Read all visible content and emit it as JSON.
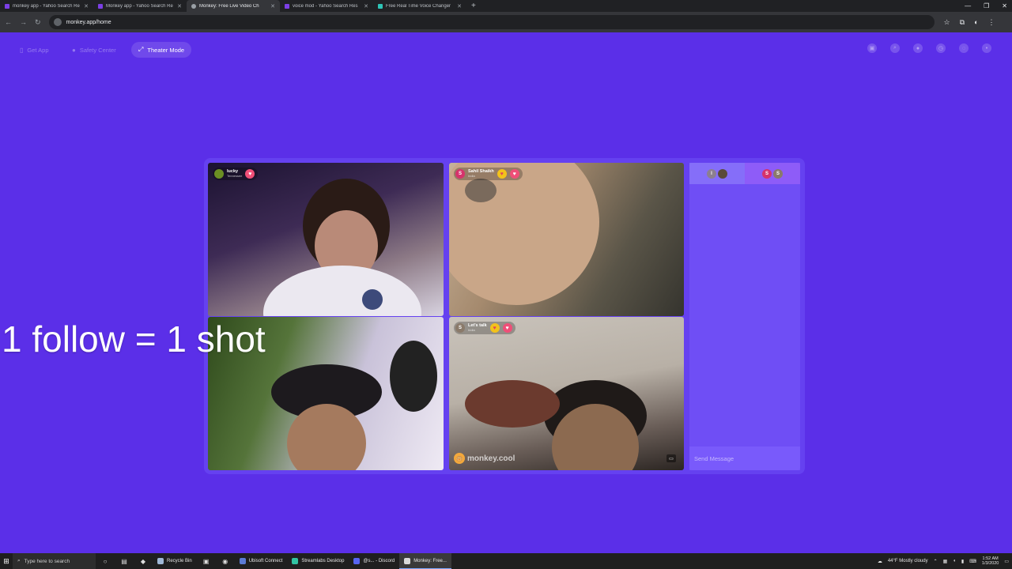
{
  "browser": {
    "tabs": [
      {
        "title": "monkey app - Yahoo Search Re",
        "fav_color": "#7b3fe4",
        "active": false
      },
      {
        "title": "Monkey app - Yahoo Search Re",
        "fav_color": "#7b3fe4",
        "active": false
      },
      {
        "title": "Monkey: Free Live Video Ch",
        "fav_color": "#9aa0a6",
        "active": true
      },
      {
        "title": "voice mod - Yahoo Search Res",
        "fav_color": "#7b3fe4",
        "active": false
      },
      {
        "title": "Free Real Time Voice Changer",
        "fav_color": "#2ec4b6",
        "active": false
      }
    ],
    "url": "monkey.app/home"
  },
  "header": {
    "get_app": "Get App",
    "safety_center": "Safety Center",
    "theater_mode": "Theater Mode"
  },
  "overlay_text": "1 follow = 1 shot",
  "participants": [
    {
      "name": "lucky",
      "location": "Tennessee",
      "initial": "",
      "avatar_color": "#6b8e23"
    },
    {
      "name": "Sahil Shaikh",
      "location": "India",
      "initial": "S",
      "avatar_color": "#d6336c"
    },
    {
      "name": "",
      "location": "",
      "initial": "",
      "avatar_color": ""
    },
    {
      "name": "Let's talk",
      "location": "India",
      "initial": "S",
      "avatar_color": "#8a7a6a"
    }
  ],
  "watermark": "monkey.cool",
  "chat": {
    "tab1_initial": "l",
    "tab2_initials": [
      "S",
      "S"
    ],
    "send_placeholder": "Send Message"
  },
  "taskbar": {
    "search_placeholder": "Type here to search",
    "apps": [
      {
        "label": "Recycle Bin",
        "color": "#9fb7d6",
        "active": false
      },
      {
        "label": "Ubisoft Connect",
        "color": "#5b7bd5",
        "active": false
      },
      {
        "label": "Streamlabs Desktop",
        "color": "#31c3a2",
        "active": false
      },
      {
        "label": "@s... - Discord",
        "color": "#5865f2",
        "active": false
      },
      {
        "label": "Monkey: Free...",
        "color": "#d9d9d9",
        "active": true
      }
    ],
    "weather": "44°F  Mostly cloudy",
    "time": "1:52 AM",
    "date": "1/3/2020"
  },
  "colors": {
    "background": "#5b2fe8",
    "heart": "#f3c21b",
    "heart_pink": "#ef4f78"
  }
}
